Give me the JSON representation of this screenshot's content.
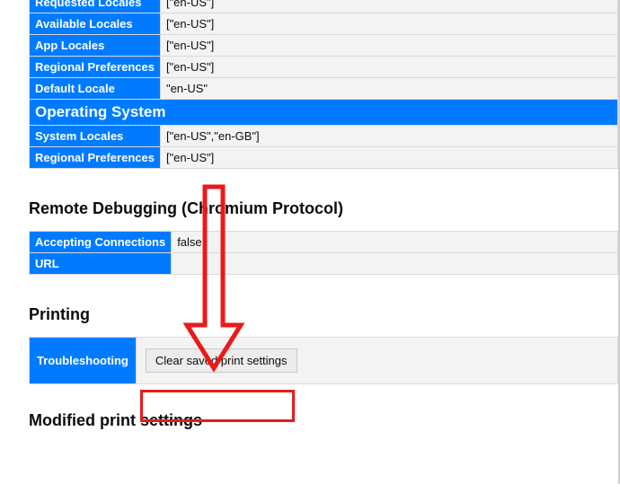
{
  "intl": {
    "rows": [
      {
        "key": "Requested Locales",
        "val": "[\"en-US\"]"
      },
      {
        "key": "Available Locales",
        "val": "[\"en-US\"]"
      },
      {
        "key": "App Locales",
        "val": "[\"en-US\"]"
      },
      {
        "key": "Regional Preferences",
        "val": "[\"en-US\"]"
      },
      {
        "key": "Default Locale",
        "val": "\"en-US\""
      }
    ],
    "os_section": "Operating System",
    "os_rows": [
      {
        "key": "System Locales",
        "val": "[\"en-US\",\"en-GB\"]"
      },
      {
        "key": "Regional Preferences",
        "val": "[\"en-US\"]"
      }
    ]
  },
  "remote": {
    "heading": "Remote Debugging (Chromium Protocol)",
    "rows": [
      {
        "key": "Accepting Connections",
        "val": "false"
      },
      {
        "key": "URL",
        "val": ""
      }
    ]
  },
  "printing": {
    "heading": "Printing",
    "row_label": "Troubleshooting",
    "button": "Clear saved print settings"
  },
  "modified": {
    "heading": "Modified print settings"
  }
}
